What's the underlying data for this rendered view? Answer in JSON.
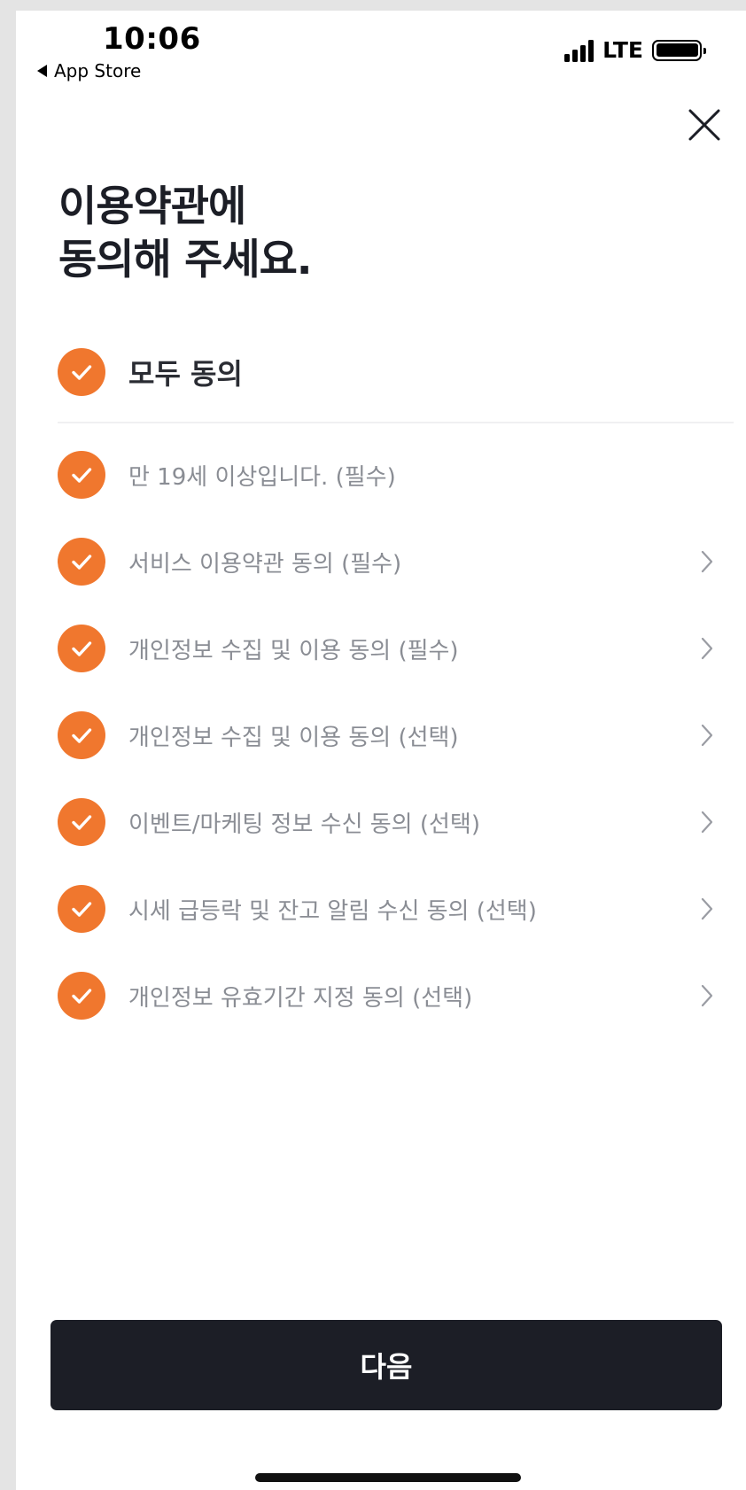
{
  "status_bar": {
    "time": "10:06",
    "back_app": "App Store",
    "network": "LTE"
  },
  "page": {
    "title": "이용약관에\n동의해 주세요.",
    "close_icon": "close-icon"
  },
  "agree_all": {
    "label": "모두 동의",
    "checked": true
  },
  "terms": [
    {
      "label": "만 19세 이상입니다. (필수)",
      "checked": true,
      "has_detail": false
    },
    {
      "label": "서비스 이용약관 동의 (필수)",
      "checked": true,
      "has_detail": true
    },
    {
      "label": "개인정보 수집 및 이용 동의 (필수)",
      "checked": true,
      "has_detail": true
    },
    {
      "label": "개인정보 수집 및 이용 동의 (선택)",
      "checked": true,
      "has_detail": true
    },
    {
      "label": "이벤트/마케팅 정보 수신 동의 (선택)",
      "checked": true,
      "has_detail": true
    },
    {
      "label": "시세 급등락 및 잔고 알림 수신 동의 (선택)",
      "checked": true,
      "has_detail": true
    },
    {
      "label": "개인정보 유효기간 지정 동의 (선택)",
      "checked": true,
      "has_detail": true
    }
  ],
  "next_button": {
    "label": "다음"
  },
  "colors": {
    "accent": "#f0772e",
    "button_bg": "#1c1e26",
    "label_text": "#8a8d94"
  }
}
